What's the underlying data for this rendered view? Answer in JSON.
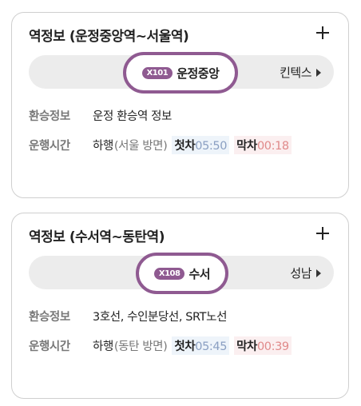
{
  "colors": {
    "line_accent": "#8f5a91",
    "first_bg": "#eef4fa",
    "last_bg": "#fbeff0"
  },
  "cards": [
    {
      "title": "역정보 (운정중앙역~서울역)",
      "station_code": "X101",
      "station_name": "운정중앙",
      "next_station": "킨텍스",
      "transfer_label": "환승정보",
      "transfer_value": "운정 환승역 정보",
      "hours_label": "운행시간",
      "direction": "하행",
      "direction_detail": "(서울 방면)",
      "first_label": "첫차",
      "first_time": "05:50",
      "last_label": "막차",
      "last_time": "00:18"
    },
    {
      "title": "역정보 (수서역~동탄역)",
      "station_code": "X108",
      "station_name": "수서",
      "next_station": "성남",
      "transfer_label": "환승정보",
      "transfer_value": "3호선, 수인분당선, SRT노선",
      "hours_label": "운행시간",
      "direction": "하행",
      "direction_detail": "(동탄 방면)",
      "first_label": "첫차",
      "first_time": "05:45",
      "last_label": "막차",
      "last_time": "00:39"
    }
  ]
}
